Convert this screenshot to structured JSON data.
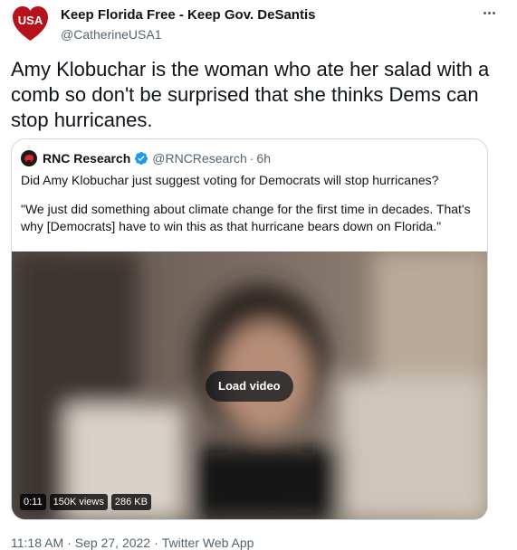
{
  "author": {
    "display_name": "Keep Florida Free - Keep Gov. DeSantis",
    "handle": "@CatherineUSA1",
    "avatar_text": "USA"
  },
  "tweet": {
    "text": "Amy Klobuchar is the woman who ate her salad with a comb so don't be surprised that she thinks Dems can stop hurricanes."
  },
  "quoted": {
    "name": "RNC Research",
    "handle": "@RNCResearch",
    "separator": "·",
    "time": "6h",
    "line1": "Did Amy Klobuchar just suggest voting for Democrats will stop hurricanes?",
    "line2": "\"We just did something about climate change for the first time in decades. That's why [Democrats] have to win this as that hurricane bears down on Florida.\"",
    "video": {
      "load_label": "Load video",
      "duration": "0:11",
      "views": "150K views",
      "size": "286 KB"
    }
  },
  "meta": {
    "time": "11:18 AM",
    "date": "Sep 27, 2022",
    "source": "Twitter Web App",
    "separator": "·"
  },
  "colors": {
    "avatar_heart": "#b5121b",
    "verified": "#1d9bf0",
    "secondary_text": "#536471",
    "border": "#cfd9de"
  }
}
